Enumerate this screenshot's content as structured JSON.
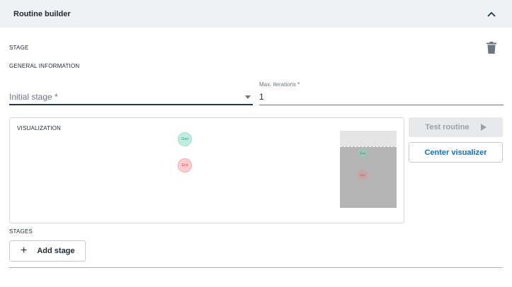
{
  "header": {
    "title": "Routine builder",
    "collapse_icon": "chevron-up-icon"
  },
  "stage": {
    "section_label": "STAGE",
    "delete_icon": "trash-icon",
    "general_label": "GENERAL INFORMATION",
    "initial_stage": {
      "placeholder": "Initial stage *",
      "value": ""
    },
    "max_iterations": {
      "label": "Max. iterations *",
      "value": "1"
    }
  },
  "visualization": {
    "title": "VISUALIZATION",
    "nodes": {
      "start": "Start",
      "end": "End"
    }
  },
  "actions": {
    "test_routine": "Test routine",
    "test_icon": "play-icon",
    "center_visualizer": "Center visualizer"
  },
  "stages": {
    "label": "STAGES",
    "add_button": "Add stage",
    "add_icon": "plus-icon"
  },
  "colors": {
    "accent": "#0e74c8",
    "start_node": "#bfeee1",
    "end_node": "#ffcdd0",
    "header_bg": "#eff1f3"
  }
}
